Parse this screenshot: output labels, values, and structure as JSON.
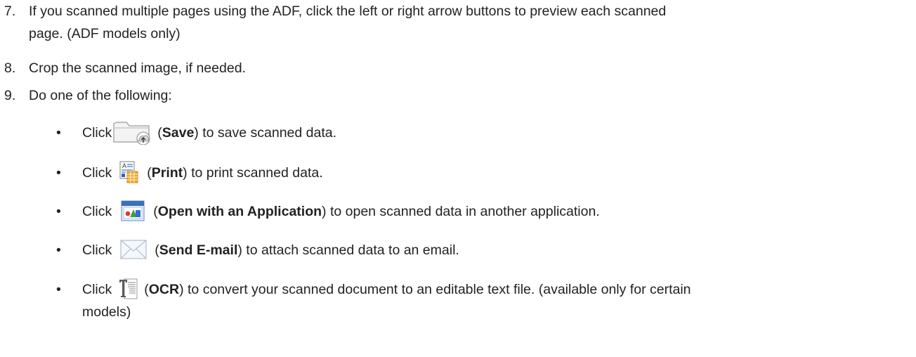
{
  "steps": [
    {
      "num": "7.",
      "text_line1": "If you scanned multiple pages using the ADF, click the left or right arrow buttons to preview each scanned",
      "text_line2": "page. (ADF models only)"
    },
    {
      "num": "8.",
      "text": "Crop the scanned image, if needed."
    },
    {
      "num": "9.",
      "text": "Do one of the following:"
    }
  ],
  "options": [
    {
      "bullet": "•",
      "click": "Click",
      "icon": "folder-save-icon",
      "open_paren": "(",
      "label": "Save",
      "close_paren": ")",
      "desc": " to save scanned data."
    },
    {
      "bullet": "•",
      "click": "Click",
      "icon": "print-icon",
      "open_paren": "(",
      "label": "Print",
      "close_paren": ")",
      "desc": " to print scanned data."
    },
    {
      "bullet": "•",
      "click": "Click",
      "icon": "open-application-icon",
      "open_paren": "(",
      "label": "Open with an Application",
      "close_paren": ")",
      "desc": " to open scanned data in another application."
    },
    {
      "bullet": "•",
      "click": "Click",
      "icon": "email-envelope-icon",
      "open_paren": "(",
      "label": "Send E-mail",
      "close_paren": ")",
      "desc": " to attach scanned data to an email."
    },
    {
      "bullet": "•",
      "click": "Click",
      "icon": "ocr-icon",
      "open_paren": "(",
      "label": "OCR",
      "close_paren": ")",
      "desc": " to convert your scanned document to an editable text file. (available only for certain",
      "desc_line2": "models)"
    }
  ]
}
